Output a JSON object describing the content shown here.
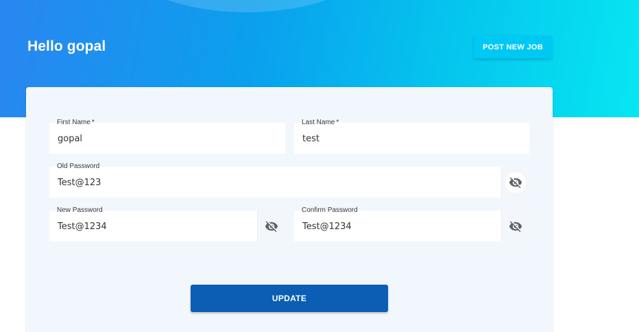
{
  "header": {
    "greeting": "Hello gopal",
    "post_job_label": "POST NEW JOB"
  },
  "form": {
    "first_name": {
      "label": "First Name",
      "required": "*",
      "value": "gopal"
    },
    "last_name": {
      "label": "Last Name",
      "required": "*",
      "value": "test"
    },
    "old_password": {
      "label": "Old Password",
      "value": "Test@123",
      "toggle_icon": "eye-off-icon"
    },
    "new_password": {
      "label": "New Password",
      "value": "Test@1234",
      "toggle_icon": "eye-off-icon"
    },
    "confirm_password": {
      "label": "Confirm Password",
      "value": "Test@1234",
      "toggle_icon": "eye-off-icon"
    },
    "update_label": "UPDATE"
  },
  "colors": {
    "hero_gradient_start": "#2a86f0",
    "hero_gradient_end": "#07e6f2",
    "post_job_button": "#00c8f4",
    "update_button": "#0b5eb3",
    "card_background": "#f2f7fe"
  }
}
